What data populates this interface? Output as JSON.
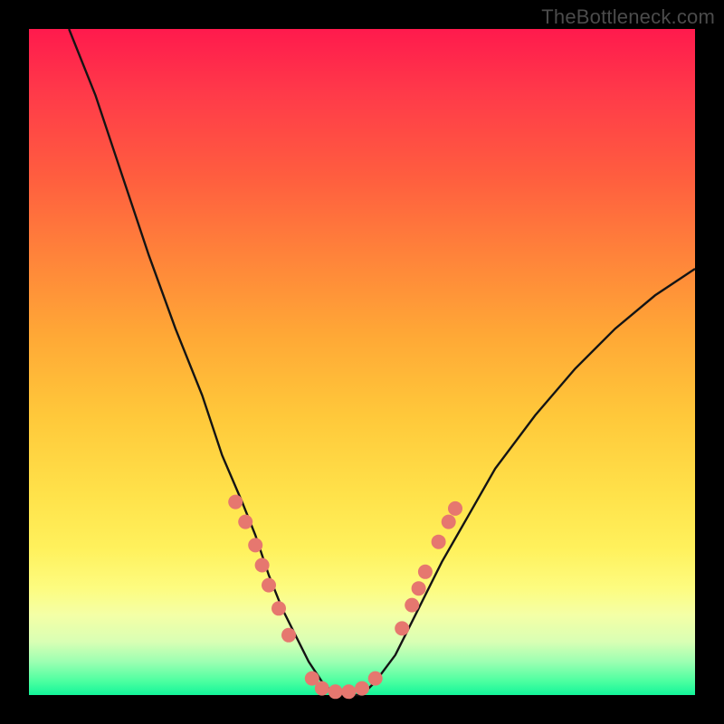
{
  "watermark": "TheBottleneck.com",
  "colors": {
    "curve": "#141414",
    "dot": "#e6776f",
    "background_black": "#000000"
  },
  "chart_data": {
    "type": "line",
    "title": "",
    "xlabel": "",
    "ylabel": "",
    "xlim": [
      0,
      100
    ],
    "ylim": [
      0,
      100
    ],
    "description": "V-shaped bottleneck curve on a vertical heat gradient (red = high bottleneck at top, green = no bottleneck at bottom). Dots mark sampled hardware pairings clustered near the valley.",
    "series": [
      {
        "name": "bottleneck-curve",
        "x": [
          6,
          10,
          14,
          18,
          22,
          26,
          29,
          32,
          34,
          36,
          38,
          40,
          42,
          44,
          46,
          48,
          50,
          52,
          55,
          58,
          62,
          66,
          70,
          76,
          82,
          88,
          94,
          100
        ],
        "y": [
          100,
          90,
          78,
          66,
          55,
          45,
          36,
          29,
          24,
          18,
          13,
          9,
          5,
          2,
          0,
          0,
          0,
          2,
          6,
          12,
          20,
          27,
          34,
          42,
          49,
          55,
          60,
          64
        ]
      }
    ],
    "points": [
      {
        "x": 31.0,
        "y": 29.0
      },
      {
        "x": 32.5,
        "y": 26.0
      },
      {
        "x": 34.0,
        "y": 22.5
      },
      {
        "x": 35.0,
        "y": 19.5
      },
      {
        "x": 36.0,
        "y": 16.5
      },
      {
        "x": 37.5,
        "y": 13.0
      },
      {
        "x": 39.0,
        "y": 9.0
      },
      {
        "x": 42.5,
        "y": 2.5
      },
      {
        "x": 44.0,
        "y": 1.0
      },
      {
        "x": 46.0,
        "y": 0.5
      },
      {
        "x": 48.0,
        "y": 0.5
      },
      {
        "x": 50.0,
        "y": 1.0
      },
      {
        "x": 52.0,
        "y": 2.5
      },
      {
        "x": 56.0,
        "y": 10.0
      },
      {
        "x": 57.5,
        "y": 13.5
      },
      {
        "x": 58.5,
        "y": 16.0
      },
      {
        "x": 59.5,
        "y": 18.5
      },
      {
        "x": 61.5,
        "y": 23.0
      },
      {
        "x": 63.0,
        "y": 26.0
      },
      {
        "x": 64.0,
        "y": 28.0
      }
    ]
  }
}
